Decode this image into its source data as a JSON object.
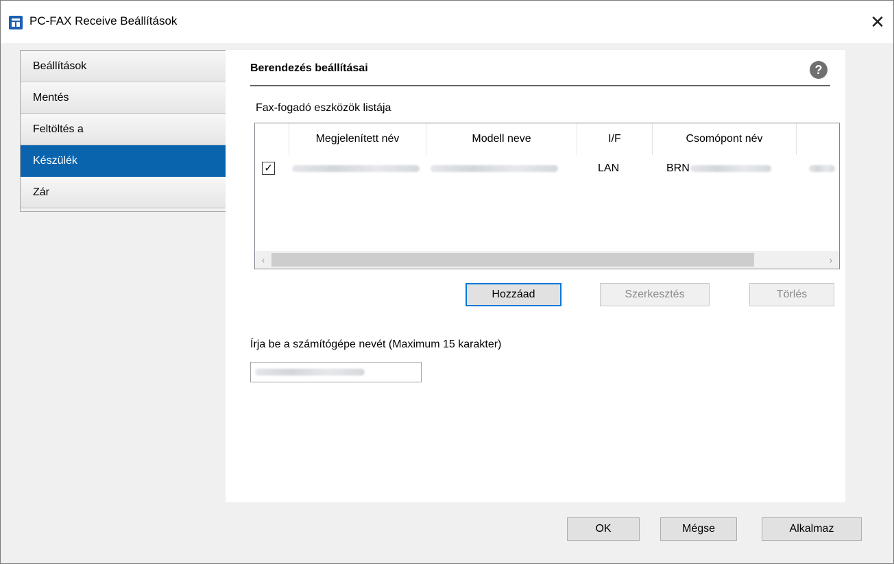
{
  "window": {
    "title": "PC-FAX Receive Beállítások",
    "app_icon": "app-window-icon",
    "close_glyph": "✕"
  },
  "nav": {
    "items": [
      {
        "label": "Beállítások",
        "selected": false
      },
      {
        "label": "Mentés",
        "selected": false
      },
      {
        "label": "Feltöltés a",
        "selected": false
      },
      {
        "label": "Készülék",
        "selected": true
      },
      {
        "label": "Zár",
        "selected": false
      }
    ]
  },
  "panel": {
    "section_title": "Berendezés beállításai",
    "help_glyph": "?",
    "list_label": "Fax-fogadó eszközök listája",
    "columns": [
      "Megjelenített név",
      "Modell neve",
      "I/F",
      "Csomópont név"
    ],
    "rows": [
      {
        "checked": true,
        "check_glyph": "✓",
        "display_name": "",
        "model_name": "",
        "interface": "LAN",
        "node_name_prefix": "BRN"
      }
    ],
    "scroll_left": "‹",
    "scroll_right": "›",
    "buttons": {
      "add": "Hozzáad",
      "edit": "Szerkesztés",
      "delete": "Törlés"
    },
    "pc_name_label": "Írja be a számítógépe nevét (Maximum 15 karakter)",
    "pc_name_value": ""
  },
  "footer": {
    "ok": "OK",
    "cancel": "Mégse",
    "apply": "Alkalmaz"
  },
  "colors": {
    "selection": "#0a63ad",
    "accent_border": "#0078d7"
  }
}
